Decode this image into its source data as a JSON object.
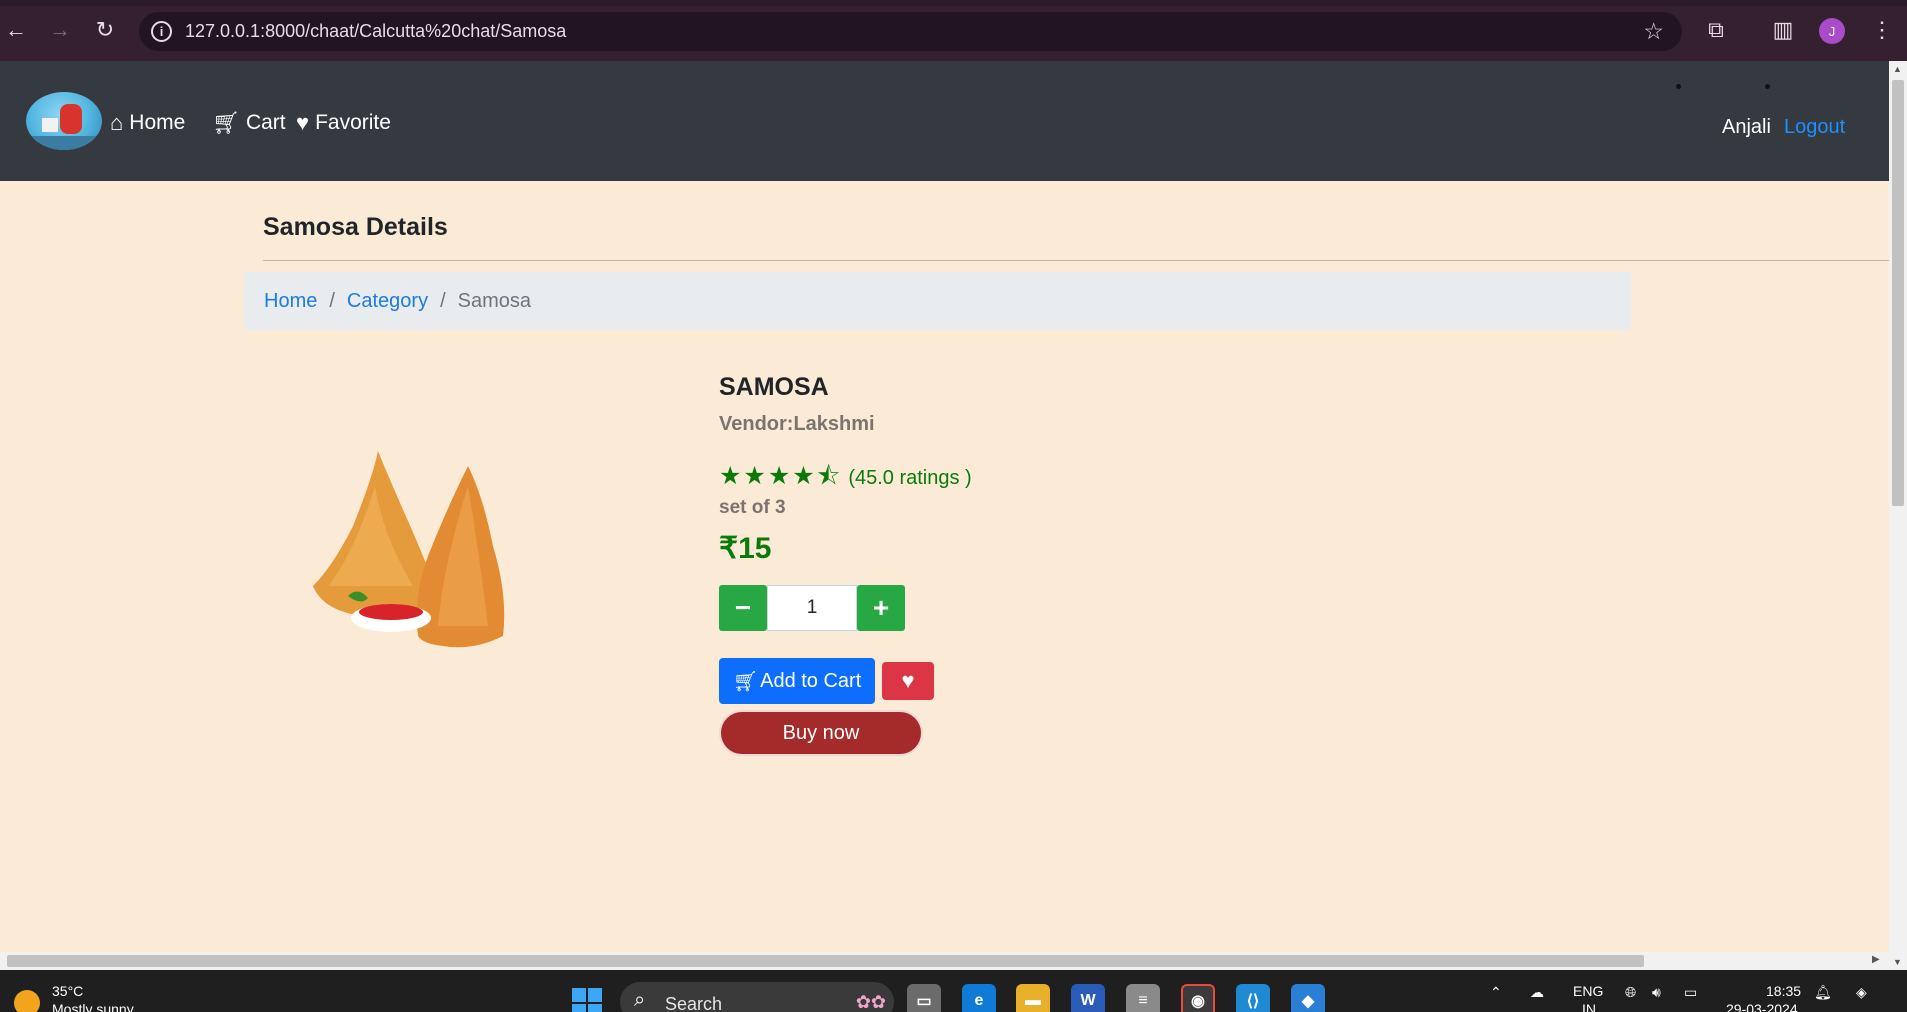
{
  "browser": {
    "url": "127.0.0.1:8000/chaat/Calcutta%20chat/Samosa",
    "profile_initial": "J"
  },
  "navbar": {
    "links": [
      {
        "label": "Home",
        "icon": "home-icon"
      },
      {
        "label": "Cart",
        "icon": "cart-icon"
      },
      {
        "label": "Favorite",
        "icon": "heart-icon"
      }
    ],
    "username": "Anjali",
    "logout_label": "Logout"
  },
  "page": {
    "title": "Samosa Details",
    "breadcrumb": {
      "home": "Home",
      "category": "Category",
      "current": "Samosa",
      "separator": "/"
    }
  },
  "product": {
    "name": "SAMOSA",
    "vendor_label": "Vendor:",
    "vendor_name": "Lakshmi",
    "stars": 4.5,
    "rating_text": "(45.0 ratings )",
    "pack": "set of 3",
    "price": "₹15",
    "quantity": "1",
    "decrement_label": "−",
    "increment_label": "+",
    "add_to_cart_label": "Add to Cart",
    "buy_now_label": "Buy now"
  },
  "taskbar": {
    "temperature": "35°C",
    "weather": "Mostly sunny",
    "search_label": "Search",
    "language": "ENG",
    "region": "IN",
    "time": "18:35",
    "date": "29-03-2024"
  },
  "colors": {
    "page_bg": "#fbebd6",
    "navbar_bg": "#343a40",
    "link_blue": "#1e7be0",
    "price_green": "#0b7a0b",
    "qty_green": "#28a745",
    "cart_blue": "#0d6efd",
    "fav_red": "#dc3545",
    "buy_brown": "#a52a2a"
  }
}
